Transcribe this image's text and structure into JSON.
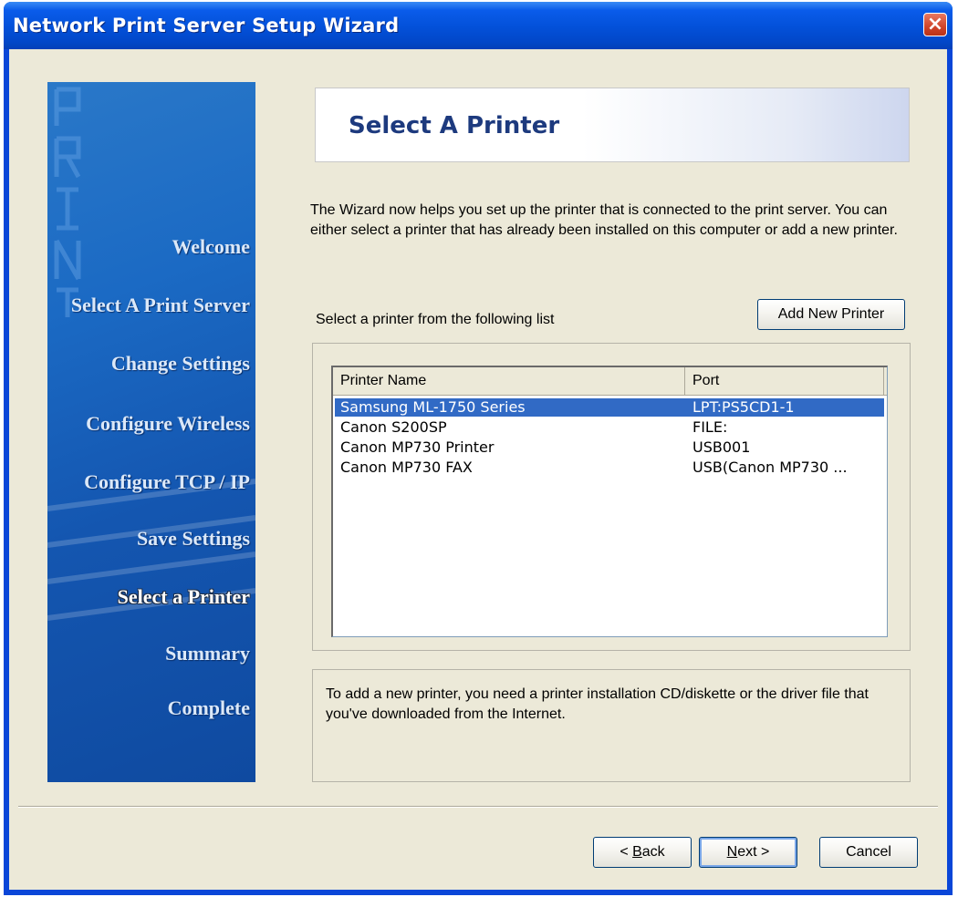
{
  "window": {
    "title": "Network Print Server Setup Wizard"
  },
  "sidebar": {
    "items": [
      {
        "label": "Welcome"
      },
      {
        "label": "Select A Print Server"
      },
      {
        "label": "Change Settings"
      },
      {
        "label": "Configure Wireless"
      },
      {
        "label": "Configure TCP / IP"
      },
      {
        "label": "Save Settings"
      },
      {
        "label": "Select a Printer"
      },
      {
        "label": "Summary"
      },
      {
        "label": "Complete"
      }
    ],
    "active_item": "Select a Printer",
    "watermark": "PRINT"
  },
  "header": {
    "title": "Select A Printer"
  },
  "main": {
    "description": "The Wizard now helps you set up the printer that is connected to the print server. You can either select a printer that has already been installed on this computer or add a new printer.",
    "list_label": "Select a printer from the following list",
    "add_printer_button": "Add New Printer",
    "printer_list": {
      "columns": [
        "Printer Name",
        "Port"
      ],
      "rows": [
        {
          "name": "Samsung ML-1750 Series",
          "port": "LPT:PS5CD1-1",
          "selected": true
        },
        {
          "name": "Canon S200SP",
          "port": "FILE:",
          "selected": false
        },
        {
          "name": "Canon MP730 Printer",
          "port": "USB001",
          "selected": false
        },
        {
          "name": "Canon MP730 FAX",
          "port": "USB(Canon MP730 ...",
          "selected": false
        }
      ]
    },
    "note": "To add a new printer, you need a printer installation CD/diskette or the driver file that you've downloaded from the Internet."
  },
  "footer": {
    "back": {
      "prefix": "< ",
      "accel": "B",
      "rest": "ack"
    },
    "next": {
      "accel": "N",
      "rest": "ext >"
    },
    "cancel": "Cancel"
  },
  "colors": {
    "titlebar": "#0350d8",
    "dialog_bg": "#ece9d8",
    "sidebar": "#1b6ac4",
    "selection": "#316ac5",
    "header_title": "#1d3a7e"
  }
}
